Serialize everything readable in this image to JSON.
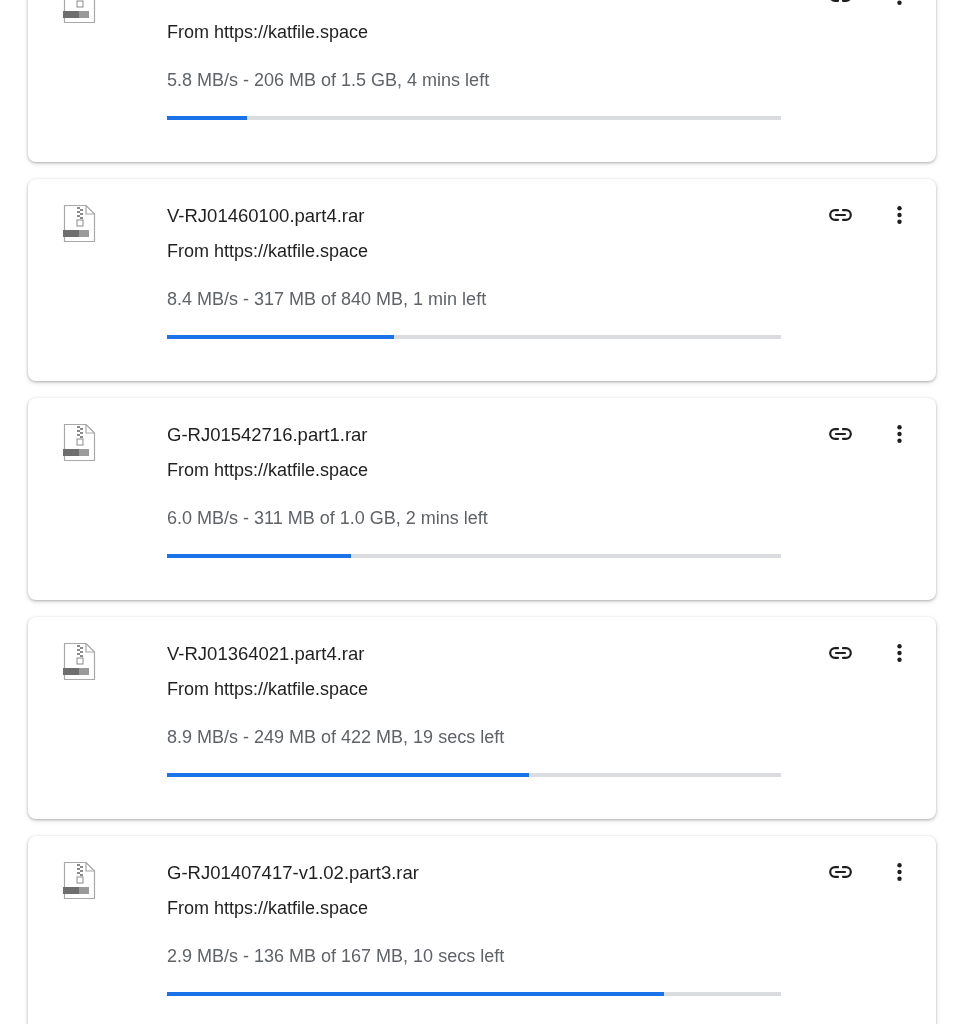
{
  "downloads": [
    {
      "source": "From https://katfile.space",
      "status": "5.8 MB/s - 206 MB of 1.5 GB, 4 mins left",
      "level": 0.13
    },
    {
      "title": "V-RJ01460100.part4.rar",
      "source": "From https://katfile.space",
      "status": "8.4 MB/s - 317 MB of 840 MB, 1 min left",
      "level": 0.37
    },
    {
      "title": "G-RJ01542716.part1.rar",
      "source": "From https://katfile.space",
      "status": "6.0 MB/s - 311 MB of 1.0 GB, 2 mins left",
      "level": 0.3
    },
    {
      "title": "V-RJ01364021.part4.rar",
      "source": "From https://katfile.space",
      "status": "8.9 MB/s - 249 MB of 422 MB, 19 secs left",
      "level": 0.59
    },
    {
      "title": "G-RJ01407417-v1.02.part3.rar",
      "source": "From https://katfile.space",
      "status": "2.9 MB/s - 136 MB of 167 MB, 10 secs left",
      "level": 0.81
    }
  ]
}
